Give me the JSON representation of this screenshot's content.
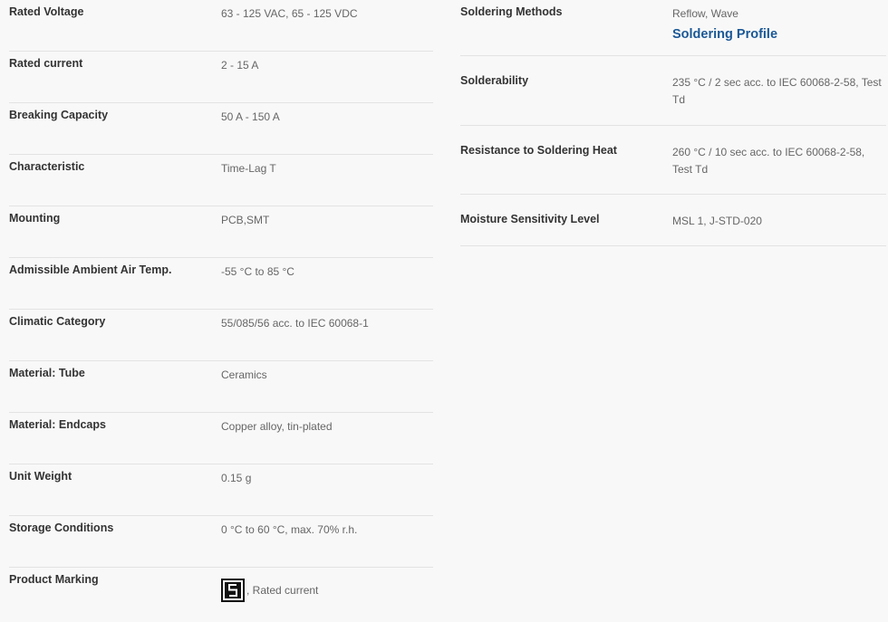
{
  "left_specs": [
    {
      "label": "Rated Voltage",
      "value": "63 - 125 VAC, 65 - 125 VDC"
    },
    {
      "label": "Rated current",
      "value": "2 - 15 A"
    },
    {
      "label": "Breaking Capacity",
      "value": "50 A - 150 A"
    },
    {
      "label": "Characteristic",
      "value": "Time-Lag T"
    },
    {
      "label": "Mounting",
      "value": "PCB,SMT"
    },
    {
      "label": "Admissible Ambient Air Temp.",
      "value": "-55 °C to 85 °C"
    },
    {
      "label": "Climatic Category",
      "value": "55/085/56 acc. to IEC 60068-1"
    },
    {
      "label": "Material: Tube",
      "value": "Ceramics"
    },
    {
      "label": "Material: Endcaps",
      "value": "Copper alloy, tin-plated"
    },
    {
      "label": "Unit Weight",
      "value": "0.15 g"
    },
    {
      "label": "Storage Conditions",
      "value": "0 °C to 60 °C, max. 70% r.h."
    },
    {
      "label": "Product Marking",
      "value": ", Rated current",
      "icon": "schurter-logo-icon"
    }
  ],
  "right_specs": [
    {
      "label": "Soldering Methods",
      "value": "Reflow, Wave",
      "link": "Soldering Profile"
    },
    {
      "label": "Solderability",
      "value": "235 °C / 2 sec acc. to IEC 60068-2-58, Test Td"
    },
    {
      "label": "Resistance to Soldering Heat",
      "value": "260 °C / 10 sec acc. to IEC 60068-2-58, Test Td"
    },
    {
      "label": "Moisture Sensitivity Level",
      "value": "MSL 1, J-STD-020"
    }
  ],
  "colors": {
    "link": "#1a5896",
    "background": "#f8f8f8",
    "divider": "#e3e3e3"
  }
}
